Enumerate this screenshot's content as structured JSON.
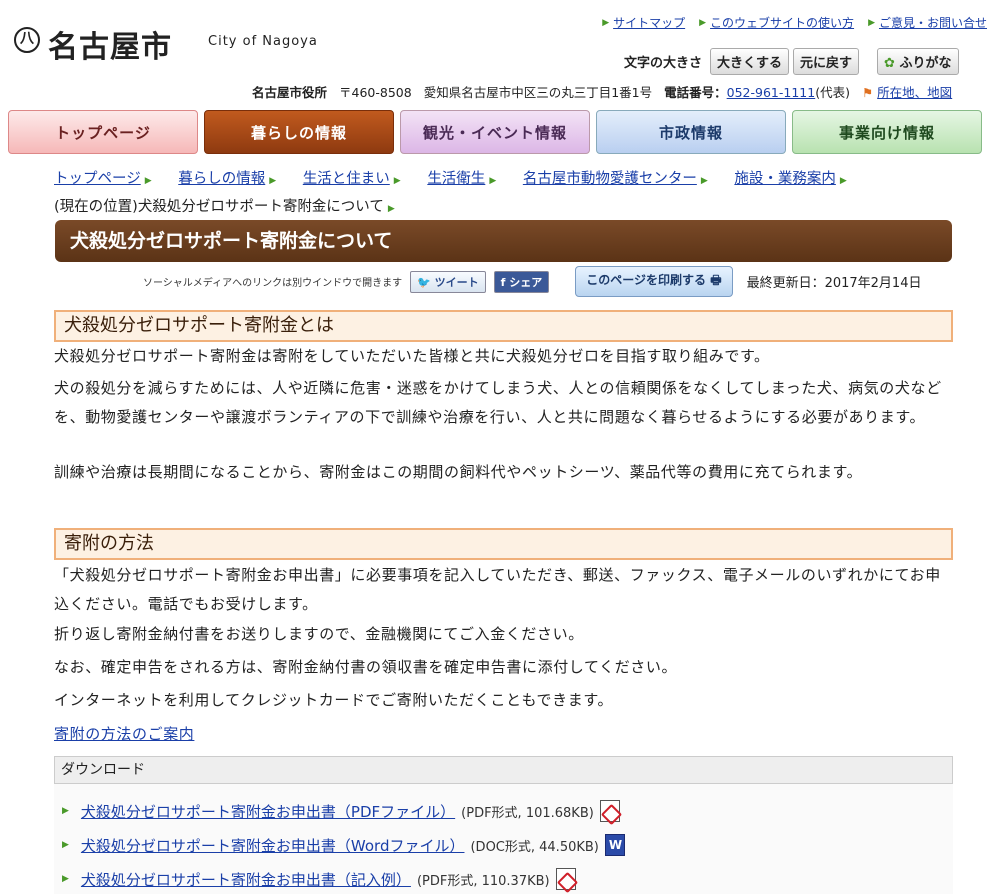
{
  "header": {
    "logo_mark": "八",
    "logo_text": "名古屋市",
    "logo_en": "City of Nagoya",
    "links": [
      "サイトマップ",
      "このウェブサイトの使い方",
      "ご意見・お問い合せ"
    ],
    "font_size_label": "文字の大きさ",
    "bigger": "大きくする",
    "reset": "元に戻す",
    "furigana": "ふりがな",
    "office": "名古屋市役所",
    "postal": "〒460-8508",
    "address": "愛知県名古屋市中区三の丸三丁目1番1号",
    "phone_label": "電話番号：",
    "phone": "052-961-1111",
    "phone_suffix": "(代表)",
    "location_link": "所在地、地図"
  },
  "nav": [
    "トップページ",
    "暮らしの情報",
    "観光・イベント情報",
    "市政情報",
    "事業向け情報"
  ],
  "breadcrumb": [
    "トップページ",
    "暮らしの情報",
    "生活と住まい",
    "生活衛生",
    "名古屋市動物愛護センター",
    "施設・業務案内"
  ],
  "breadcrumb_current": "(現在の位置)犬殺処分ゼロサポート寄附金について",
  "page_title": "犬殺処分ゼロサポート寄附金について",
  "social": {
    "note": "ソーシャルメディアへのリンクは別ウインドウで開きます",
    "tweet": "ツイート",
    "share": "シェア",
    "print": "このページを印刷する",
    "updated": "最終更新日：2017年2月14日"
  },
  "section1": {
    "heading": "犬殺処分ゼロサポート寄附金とは",
    "p1": "犬殺処分ゼロサポート寄附金は寄附をしていただいた皆様と共に犬殺処分ゼロを目指す取り組みです。",
    "p2": "犬の殺処分を減らすためには、人や近隣に危害・迷惑をかけてしまう犬、人との信頼関係をなくしてしまった犬、病気の犬などを、動物愛護センターや譲渡ボランティアの下で訓練や治療を行い、人と共に問題なく暮らせるようにする必要があります。",
    "p3": "訓練や治療は長期間になることから、寄附金はこの期間の飼料代やペットシーツ、薬品代等の費用に充てられます。"
  },
  "section2": {
    "heading": "寄附の方法",
    "p1": "「犬殺処分ゼロサポート寄附金お申出書」に必要事項を記入していただき、郵送、ファックス、電子メールのいずれかにてお申込ください。電話でもお受けします。",
    "p2": "折り返し寄附金納付書をお送りしますので、金融機関にてご入金ください。",
    "p3": "なお、確定申告をされる方は、寄附金納付書の領収書を確定申告書に添付してください。",
    "p4": "インターネットを利用してクレジットカードでご寄附いただくこともできます。",
    "link": "寄附の方法のご案内"
  },
  "download": {
    "heading": "ダウンロード",
    "items": [
      {
        "label": "犬殺処分ゼロサポート寄附金お申出書（PDFファイル）",
        "meta": "(PDF形式, 101.68KB)",
        "icon": "pdf-icon"
      },
      {
        "label": "犬殺処分ゼロサポート寄附金お申出書（Wordファイル）",
        "meta": "(DOC形式, 44.50KB)",
        "icon": "word-icon"
      },
      {
        "label": "犬殺処分ゼロサポート寄附金お申出書（記入例）",
        "meta": "(PDF形式, 110.37KB)",
        "icon": "pdf-icon"
      }
    ]
  }
}
